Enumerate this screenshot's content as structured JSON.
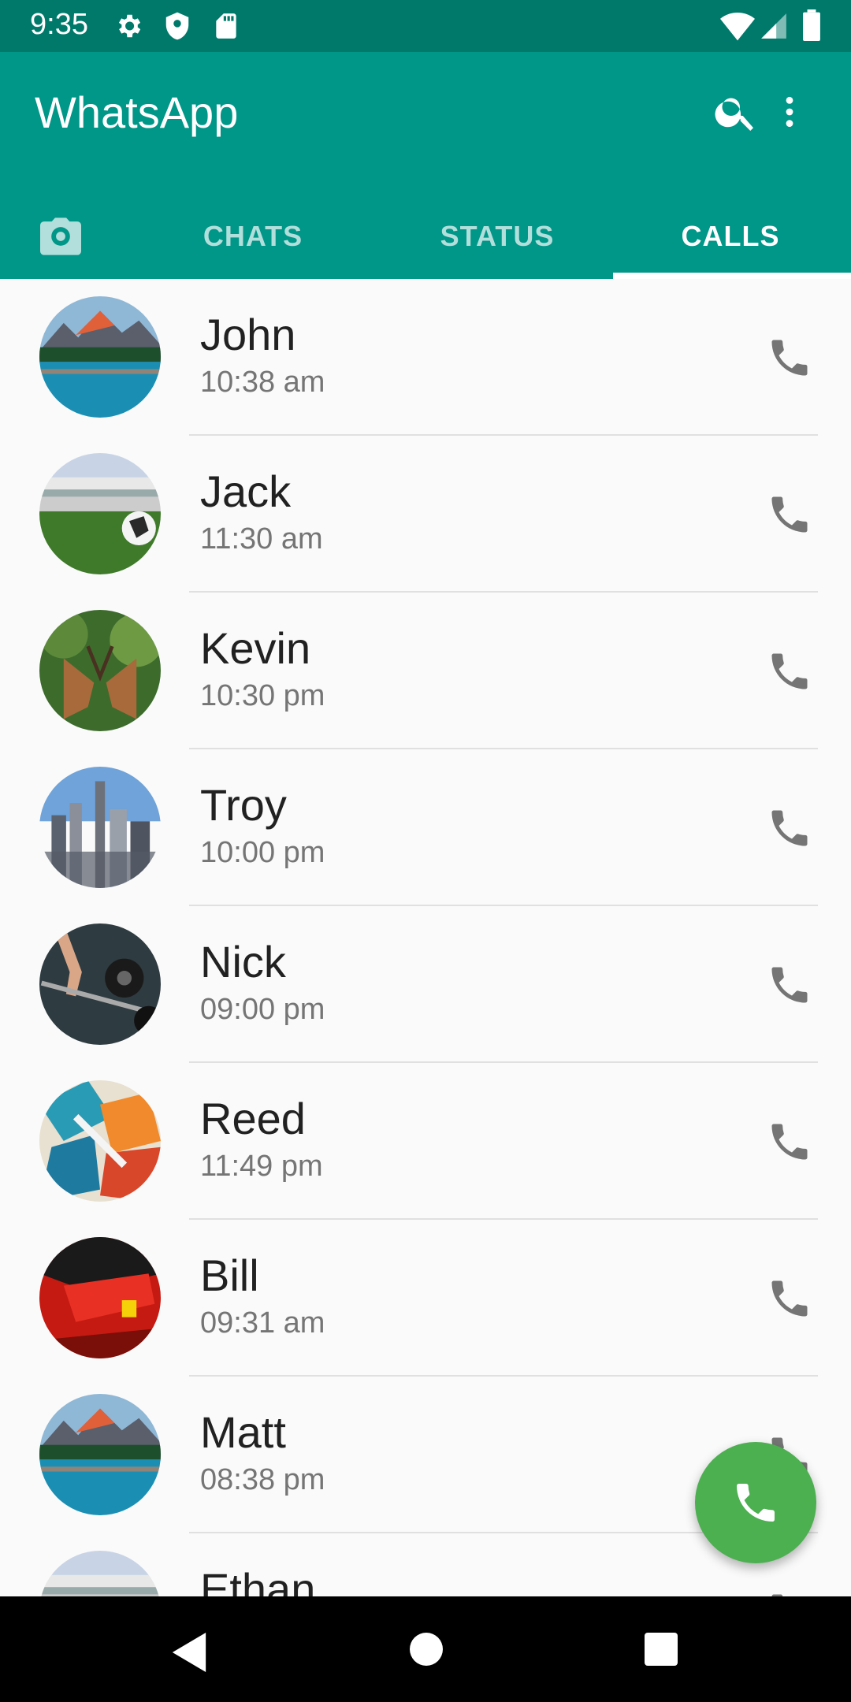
{
  "status_bar": {
    "time": "9:35",
    "icons": [
      "gear-icon",
      "shield-icon",
      "sd-card-icon",
      "wifi-icon",
      "signal-icon",
      "battery-icon"
    ]
  },
  "app_bar": {
    "title": "WhatsApp",
    "icons": [
      "search-icon",
      "more-vert-icon"
    ]
  },
  "tabs": {
    "camera_icon": "camera-icon",
    "items": [
      {
        "label": "CHATS"
      },
      {
        "label": "STATUS"
      },
      {
        "label": "CALLS",
        "active": true
      }
    ]
  },
  "calls": [
    {
      "name": "John",
      "time": "10:38 am",
      "avatar": "lake-mountains"
    },
    {
      "name": "Jack",
      "time": "11:30 am",
      "avatar": "stadium-football"
    },
    {
      "name": "Kevin",
      "time": "10:30 pm",
      "avatar": "deer"
    },
    {
      "name": "Troy",
      "time": "10:00 pm",
      "avatar": "city-skyline"
    },
    {
      "name": "Nick",
      "time": "09:00 pm",
      "avatar": "barbell"
    },
    {
      "name": "Reed",
      "time": "11:49 pm",
      "avatar": "abstract-paint"
    },
    {
      "name": "Bill",
      "time": "09:31 am",
      "avatar": "red-car"
    },
    {
      "name": "Matt",
      "time": "08:38 pm",
      "avatar": "lake-mountains"
    },
    {
      "name": "Ethan",
      "time": "",
      "avatar": "stadium-football"
    }
  ],
  "fab": {
    "icon": "phone-icon"
  },
  "colors": {
    "primary": "#009688",
    "primary_dark": "#00796b",
    "fab": "#4caf50",
    "tab_inactive": "#b2dfdb",
    "call_icon": "#757575"
  }
}
